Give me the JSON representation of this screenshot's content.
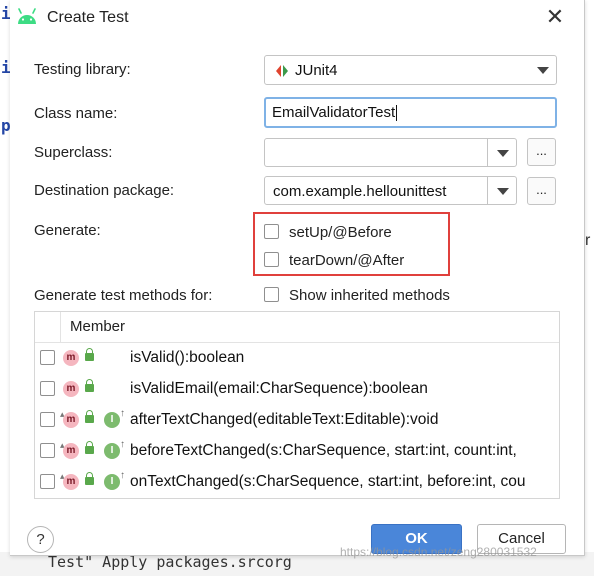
{
  "dialog": {
    "title": "Create Test",
    "close_glyph": "✕"
  },
  "form": {
    "testing_library_label": "Testing library:",
    "testing_library_value": "JUnit4",
    "class_name_label": "Class name:",
    "class_name_value": "EmailValidatorTest",
    "superclass_label": "Superclass:",
    "superclass_value": "",
    "destination_package_label": "Destination package:",
    "destination_package_value": "com.example.hellounittest",
    "browse_label": "...",
    "generate_label": "Generate:",
    "generate_options": [
      {
        "label": "setUp/@Before",
        "checked": false
      },
      {
        "label": "tearDown/@After",
        "checked": false
      }
    ],
    "generate_methods_label": "Generate test methods for:",
    "show_inherited_label": "Show inherited methods"
  },
  "members": {
    "header": "Member",
    "rows": [
      {
        "name": "isValid():boolean",
        "icons": [
          "method-icon",
          "public-lock-icon"
        ]
      },
      {
        "name": "isValidEmail(email:CharSequence):boolean",
        "icons": [
          "method-icon",
          "public-lock-icon"
        ]
      },
      {
        "name": "afterTextChanged(editableText:Editable):void",
        "icons": [
          "override-method-icon",
          "public-lock-icon",
          "interface-icon"
        ]
      },
      {
        "name": "beforeTextChanged(s:CharSequence, start:int, count:int,",
        "icons": [
          "override-method-icon",
          "public-lock-icon",
          "interface-icon"
        ]
      },
      {
        "name": "onTextChanged(s:CharSequence, start:int, before:int, cou",
        "icons": [
          "override-method-icon",
          "public-lock-icon",
          "interface-icon"
        ]
      }
    ]
  },
  "footer": {
    "help_label": "?",
    "ok_label": "OK",
    "cancel_label": "Cancel"
  },
  "background": {
    "left_glyphs": [
      "i",
      "i",
      "p"
    ],
    "right_glyph": "r",
    "bottom_text": "Test\"     Apply packages.srcorg"
  },
  "watermark": "https://blog.csdn.net/zeng280031532",
  "colors": {
    "accent": "#4a86d9",
    "highlight_box": "#e0403c",
    "input_focus": "#7fb2e6"
  }
}
